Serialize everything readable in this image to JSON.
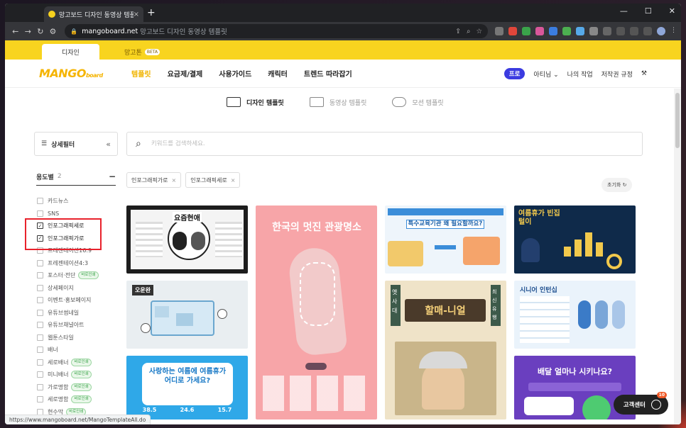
{
  "browser": {
    "tab_title": "망고보드 디자인 동영상 템플릿",
    "url_host": "mangoboard.net",
    "url_rest": "망고보드 디자인 동영상 템플릿",
    "status_url": "https://www.mangoboard.net/MangoTemplateAll.do"
  },
  "service_tabs": [
    {
      "label": "디자인",
      "active": true
    },
    {
      "label": "망고톤",
      "badge": "BETA",
      "active": false
    }
  ],
  "header": {
    "logo": "MANGO",
    "logo_small": "board",
    "nav": [
      "템플릿",
      "요금제/결제",
      "사용가이드",
      "캐릭터",
      "트렌드 따라잡기"
    ],
    "pro_badge": "프로",
    "user": "아티님",
    "my_work": "나의 작업",
    "copyright": "저작권 규정"
  },
  "type_tabs": [
    "디자인 템플릿",
    "동영상 템플릿",
    "모션 템플릿"
  ],
  "filter": {
    "label": "상세필터",
    "search_placeholder": "키워드를 검색하세요."
  },
  "category": {
    "title": "용도별",
    "count": "2",
    "items": [
      {
        "label": "카드뉴스",
        "checked": false
      },
      {
        "label": "SNS",
        "checked": false
      },
      {
        "label": "인포그래픽세로",
        "checked": true
      },
      {
        "label": "인포그래픽가로",
        "checked": true
      },
      {
        "label": "프레젠테이션16:9",
        "checked": false
      },
      {
        "label": "프레젠테이션4:3",
        "checked": false
      },
      {
        "label": "포스터·전단",
        "checked": false,
        "badge": "바로인쇄"
      },
      {
        "label": "상세페이지",
        "checked": false
      },
      {
        "label": "이벤트·홍보페이지",
        "checked": false
      },
      {
        "label": "유튜브썸네일",
        "checked": false
      },
      {
        "label": "유튜브채널아트",
        "checked": false
      },
      {
        "label": "웹툰스타일",
        "checked": false
      },
      {
        "label": "배너",
        "checked": false
      },
      {
        "label": "세로배너",
        "checked": false,
        "badge": "바로인쇄"
      },
      {
        "label": "미니배너",
        "checked": false,
        "badge": "바로인쇄"
      },
      {
        "label": "가로명함",
        "checked": false,
        "badge": "바로인쇄"
      },
      {
        "label": "세로명함",
        "checked": false,
        "badge": "바로인쇄"
      },
      {
        "label": "현수막",
        "checked": false,
        "badge": "바로인쇄"
      }
    ]
  },
  "active_chips": [
    "인포그래픽가로",
    "인포그래픽세로"
  ],
  "reset_label": "초기화",
  "templates": [
    {
      "title": "요즘현애"
    },
    {
      "title": "한국의 멋진 관광명소"
    },
    {
      "title": "특수교육기관 왜 필요할까요?"
    },
    {
      "title": "여름휴가 빈집털이"
    },
    {
      "title": "오운완"
    },
    {
      "title": "할매-니얼"
    },
    {
      "title": "시니어 인턴십"
    },
    {
      "title": "사랑하는 여름에 여름휴가 어디로 가세요?"
    },
    {
      "title": "배달 얼마나 시키나요?"
    }
  ],
  "template_texts": {
    "side_left": "옛\n사\n대",
    "side_right": "최\n신\n유\n행",
    "percents": [
      "38.5",
      "24.6",
      "15.7"
    ]
  },
  "help": {
    "label": "고객센터",
    "badge": "10"
  },
  "colors": {
    "brand_yellow": "#f8d41f",
    "pro_blue": "#3b3be0",
    "highlight_red": "#e8222c"
  }
}
